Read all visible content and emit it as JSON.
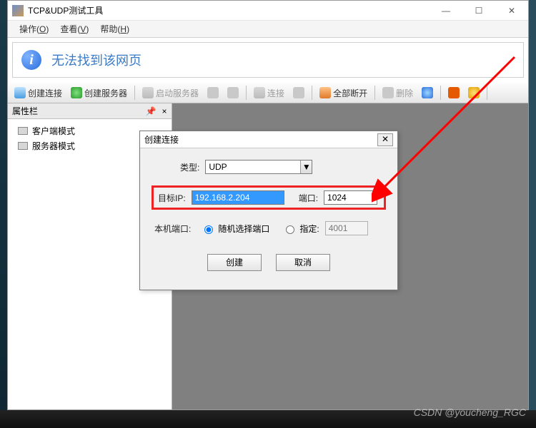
{
  "window": {
    "title": "TCP&UDP测试工具",
    "sysbuttons": {
      "min": "—",
      "max": "☐",
      "close": "✕"
    }
  },
  "menubar": {
    "operate": {
      "label": "操作",
      "accel": "O"
    },
    "view": {
      "label": "查看",
      "accel": "V"
    },
    "help": {
      "label": "帮助",
      "accel": "H"
    }
  },
  "banner": {
    "icon_glyph": "i",
    "text": "无法找到该网页"
  },
  "toolbar": {
    "create_conn": "创建连接",
    "create_server": "创建服务器",
    "start_server": "启动服务器",
    "connect": "连接",
    "disconnect_all": "全部断开",
    "delete": "删除"
  },
  "properties_panel": {
    "title": "属性栏",
    "items": [
      "客户端模式",
      "服务器模式"
    ]
  },
  "dialog": {
    "title": "创建连接",
    "type_label": "类型:",
    "type_value": "UDP",
    "target_ip_label": "目标IP:",
    "target_ip_value": "192.168.2.204",
    "port_label": "端口:",
    "port_value": "1024",
    "local_port_label": "本机端口:",
    "random_port_label": "随机选择端口",
    "specify_label": "指定:",
    "specify_value": "4001",
    "random_selected": true,
    "create_btn": "创建",
    "cancel_btn": "取消"
  },
  "watermark": "CSDN @youcheng_RGC"
}
